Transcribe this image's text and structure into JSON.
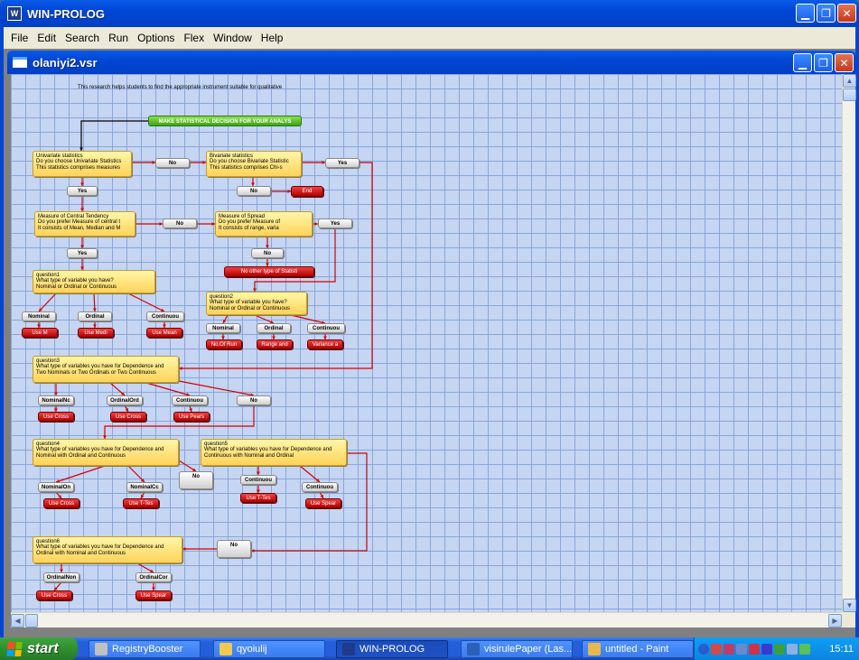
{
  "app": {
    "title": "WIN-PROLOG",
    "icon_text": "W"
  },
  "menu": [
    "File",
    "Edit",
    "Search",
    "Run",
    "Options",
    "Flex",
    "Window",
    "Help"
  ],
  "document": {
    "title": "olaniyi2.vsr"
  },
  "diagram": {
    "heading": "This research helps students to find the appropriate instrument suitable for qualitative",
    "nodes": [
      {
        "id": "start",
        "kind": "g",
        "lines": [
          "MAKE STATISTICAL DECISION FOR YOUR ANALYS"
        ]
      },
      {
        "id": "univariate",
        "kind": "q",
        "lines": [
          "Univariate statistics",
          "Do you choose Univariate Statistics",
          "This statistics comprises measures"
        ]
      },
      {
        "id": "no1",
        "kind": "b",
        "lines": [
          "No"
        ]
      },
      {
        "id": "bivariate",
        "kind": "q",
        "lines": [
          "Bivariate statistics",
          "Do you choose Bivariate Statistic",
          "This statistics comprises Chi-s"
        ]
      },
      {
        "id": "yes_biv",
        "kind": "b",
        "lines": [
          "Yes"
        ]
      },
      {
        "id": "yes1",
        "kind": "b",
        "lines": [
          "Yes"
        ]
      },
      {
        "id": "no_biv",
        "kind": "b",
        "lines": [
          "No"
        ]
      },
      {
        "id": "end",
        "kind": "r",
        "lines": [
          "End"
        ]
      },
      {
        "id": "central",
        "kind": "q",
        "lines": [
          "Measure of Central Tendency",
          "Do you prefer Measure of central t",
          "It consists of Mean, Median and M"
        ]
      },
      {
        "id": "no2",
        "kind": "b",
        "lines": [
          "No"
        ]
      },
      {
        "id": "spread",
        "kind": "q",
        "lines": [
          "Measure of Spread",
          "Do you prefer Measure of",
          "It consists of range, varia"
        ]
      },
      {
        "id": "yes_spread",
        "kind": "b",
        "lines": [
          "Yes"
        ]
      },
      {
        "id": "yes2",
        "kind": "b",
        "lines": [
          "Yes"
        ]
      },
      {
        "id": "no_spread",
        "kind": "b",
        "lines": [
          "No"
        ]
      },
      {
        "id": "no_other",
        "kind": "r",
        "lines": [
          "No other type of Statisti"
        ]
      },
      {
        "id": "question1",
        "kind": "q",
        "lines": [
          "question1",
          "What type of variable you have?",
          "Nominal or Ordinal or Continuous"
        ]
      },
      {
        "id": "question2",
        "kind": "q",
        "lines": [
          "question2",
          "What type of variable you have?",
          "Nominal or Ordinal or Continuous"
        ]
      },
      {
        "id": "q1_nominal",
        "kind": "b",
        "lines": [
          "Nominal"
        ]
      },
      {
        "id": "q1_ordinal",
        "kind": "b",
        "lines": [
          "Ordinal"
        ]
      },
      {
        "id": "q1_cont",
        "kind": "b",
        "lines": [
          "Continuou"
        ]
      },
      {
        "id": "q1_r1",
        "kind": "r",
        "lines": [
          "Use M"
        ]
      },
      {
        "id": "q1_r2",
        "kind": "r",
        "lines": [
          "Use Medi"
        ]
      },
      {
        "id": "q1_r3",
        "kind": "r",
        "lines": [
          "Use Mean"
        ]
      },
      {
        "id": "q2_nominal",
        "kind": "b",
        "lines": [
          "Nominal"
        ]
      },
      {
        "id": "q2_ordinal",
        "kind": "b",
        "lines": [
          "Ordinal"
        ]
      },
      {
        "id": "q2_cont",
        "kind": "b",
        "lines": [
          "Continuou"
        ]
      },
      {
        "id": "q2_r1",
        "kind": "r",
        "lines": [
          "No.Of Run"
        ]
      },
      {
        "id": "q2_r2",
        "kind": "r",
        "lines": [
          "Range and"
        ]
      },
      {
        "id": "q2_r3",
        "kind": "r",
        "lines": [
          "Variance a"
        ]
      },
      {
        "id": "question3",
        "kind": "q",
        "lines": [
          "question3",
          "What type of variables you have for Dependence and",
          "Two Nominals or Two Ordinals or Two Continuous"
        ]
      },
      {
        "id": "q3_a",
        "kind": "b",
        "lines": [
          "NominalNc"
        ]
      },
      {
        "id": "q3_b",
        "kind": "b",
        "lines": [
          "OrdinalOrd"
        ]
      },
      {
        "id": "q3_c",
        "kind": "b",
        "lines": [
          "Continuou"
        ]
      },
      {
        "id": "q3_no",
        "kind": "b",
        "lines": [
          "No"
        ]
      },
      {
        "id": "q3_r1",
        "kind": "r",
        "lines": [
          "Use Cross"
        ]
      },
      {
        "id": "q3_r2",
        "kind": "r",
        "lines": [
          "Use Cross"
        ]
      },
      {
        "id": "q3_r3",
        "kind": "r",
        "lines": [
          "Use Pears"
        ]
      },
      {
        "id": "question4",
        "kind": "q",
        "lines": [
          "question4",
          "What type of variables you have for Dependence and",
          "Nominal with Ordinal and Continuous"
        ]
      },
      {
        "id": "question5",
        "kind": "q",
        "lines": [
          "question5",
          "What type of variables you have for Dependence and",
          "Continuous with Nominal and Ordinal"
        ]
      },
      {
        "id": "q4_no",
        "kind": "b",
        "lines": [
          "No"
        ]
      },
      {
        "id": "q4_a",
        "kind": "b",
        "lines": [
          "NominalOn"
        ]
      },
      {
        "id": "q4_b",
        "kind": "b",
        "lines": [
          "NominalCc"
        ]
      },
      {
        "id": "q4_r1",
        "kind": "r",
        "lines": [
          "Use Cross"
        ]
      },
      {
        "id": "q4_r2",
        "kind": "r",
        "lines": [
          "Use T-Tes"
        ]
      },
      {
        "id": "q5_a",
        "kind": "b",
        "lines": [
          "Continuou"
        ]
      },
      {
        "id": "q5_b",
        "kind": "b",
        "lines": [
          "Continuou"
        ]
      },
      {
        "id": "q5_r1",
        "kind": "r",
        "lines": [
          "Use T-Tes"
        ]
      },
      {
        "id": "q5_r2",
        "kind": "r",
        "lines": [
          "Use Spear"
        ]
      },
      {
        "id": "question6",
        "kind": "q",
        "lines": [
          "question6",
          "What type of variables you have for Dependence and",
          "Ordinal with Nominal and Continuous"
        ]
      },
      {
        "id": "q6_no",
        "kind": "b",
        "lines": [
          "No"
        ]
      },
      {
        "id": "q6_a",
        "kind": "b",
        "lines": [
          "OrdinalNon"
        ]
      },
      {
        "id": "q6_b",
        "kind": "b",
        "lines": [
          "OrdinalCor"
        ]
      },
      {
        "id": "q6_r1",
        "kind": "r",
        "lines": [
          "Use Cross"
        ]
      },
      {
        "id": "q6_r2",
        "kind": "r",
        "lines": [
          "Use Spear"
        ]
      }
    ]
  },
  "taskbar": {
    "start_label": "start",
    "tasks": [
      {
        "label": "RegistryBooster",
        "icon_color": "#c0c0c0"
      },
      {
        "label": "qyoiulij",
        "icon_color": "#f2c94c"
      },
      {
        "label": "WIN-PROLOG",
        "icon_color": "#1d3c8c",
        "active": true
      },
      {
        "label": "visirulePaper (Las...",
        "icon_color": "#2b5fb8"
      },
      {
        "label": "untitled - Paint",
        "icon_color": "#e8b84a"
      }
    ],
    "clock": "15:11"
  },
  "colors": {
    "xp_blue": "#0046d5",
    "grid": "#c5d5f2",
    "question_fill": "#ffd35a",
    "answer_fill": "#cfcfcf",
    "result_fill": "#b00000",
    "start_fill": "#3aa11a",
    "edge_dark": "#000000",
    "edge_red": "#d40000"
  }
}
